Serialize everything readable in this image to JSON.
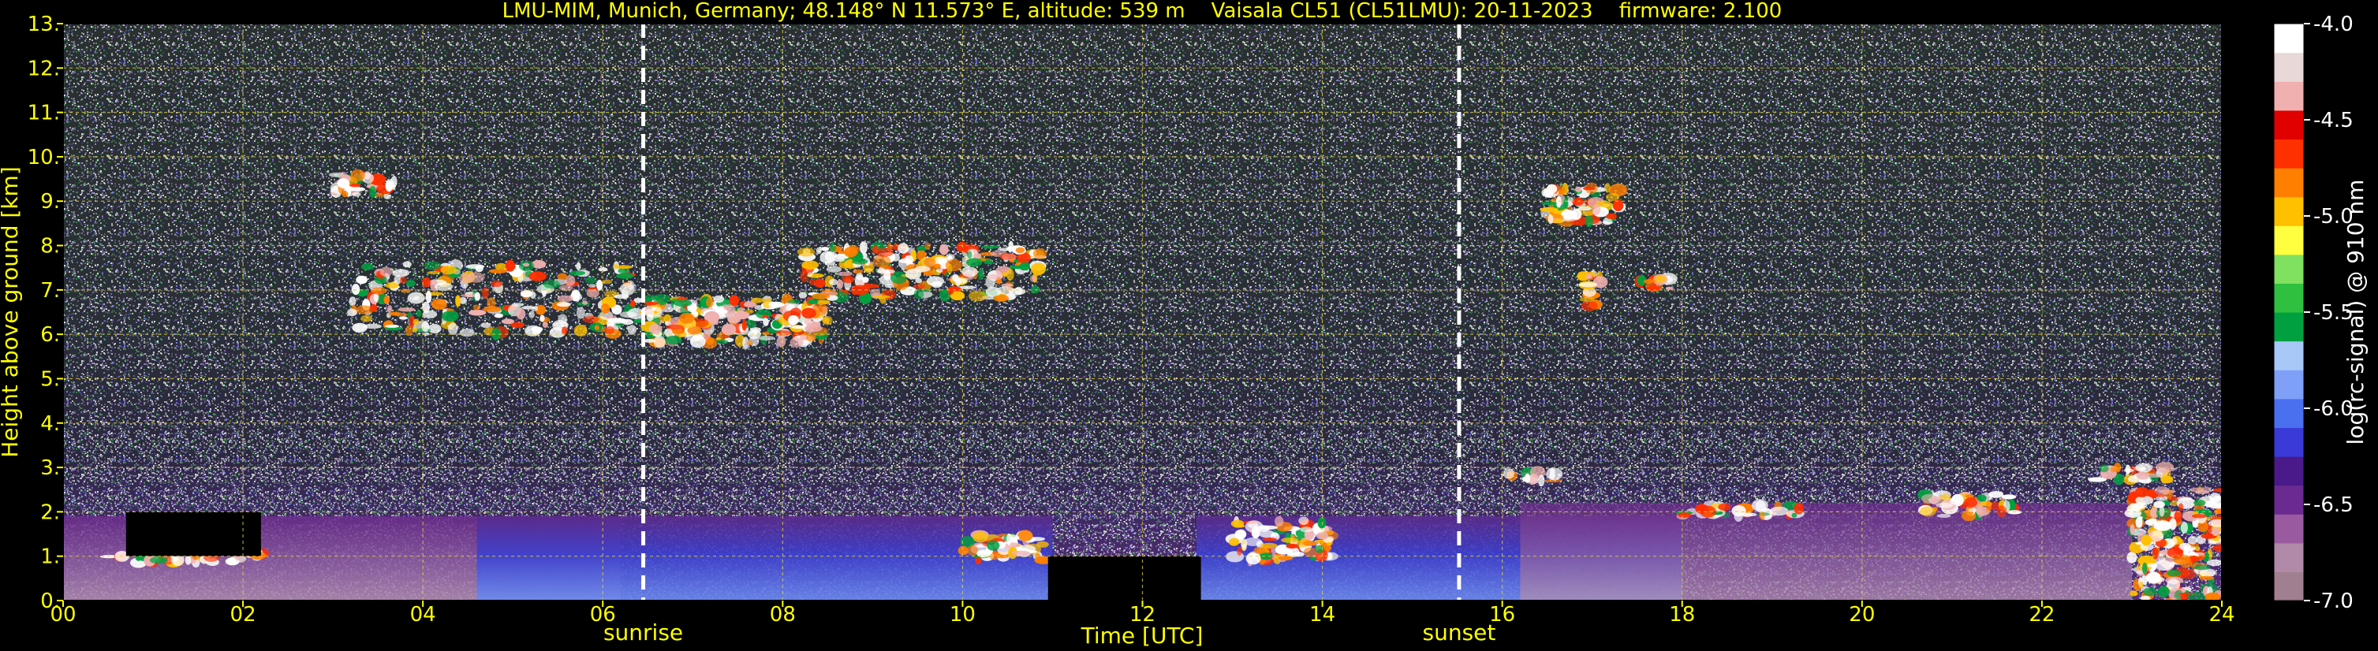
{
  "chart_data": {
    "type": "heatmap",
    "title": "LMU-MIM, Munich, Germany; 48.148° N 11.573° E, altitude: 539 m    Vaisala CL51 (CL51LMU): 20-11-2023    firmware: 2.100",
    "xlabel": "Time [UTC]",
    "ylabel": "Height above ground [km]",
    "xlim": [
      0,
      24
    ],
    "ylim": [
      0,
      13
    ],
    "x_ticks": [
      "00",
      "02",
      "04",
      "06",
      "08",
      "10",
      "12",
      "14",
      "16",
      "18",
      "20",
      "22",
      "24"
    ],
    "y_ticks": [
      "0.",
      "1.",
      "2.",
      "3.",
      "4.",
      "5.",
      "6.",
      "7.",
      "8.",
      "9.",
      "10.",
      "11.",
      "12.",
      "13."
    ],
    "grid": true,
    "colorbar": {
      "label": "log(rc-signal) @ 910 nm",
      "range": [
        -7.0,
        -4.0
      ],
      "ticks": [
        "-4.0",
        "-4.5",
        "-5.0",
        "-5.5",
        "-6.0",
        "-6.5",
        "-7.0"
      ],
      "colors": [
        "#a08090",
        "#b08aa8",
        "#9a5aa0",
        "#6a2a90",
        "#4a1a8a",
        "#3a3ad8",
        "#4a70f0",
        "#80a0f8",
        "#a8c8f8",
        "#00a040",
        "#30c040",
        "#80e060",
        "#ffff40",
        "#ffc000",
        "#ff8000",
        "#ff3000",
        "#e00000",
        "#f0b0b0",
        "#e8d8d8",
        "#ffffff"
      ]
    },
    "markers": [
      {
        "label": "sunrise",
        "x": 6.45
      },
      {
        "label": "sunset",
        "x": 15.52
      }
    ],
    "features": [
      {
        "type": "cloud",
        "x": [
          0.5,
          2.2
        ],
        "y": [
          0.85,
          1.1
        ]
      },
      {
        "type": "cloud",
        "x": [
          3.0,
          3.7
        ],
        "y": [
          9.1,
          9.6
        ]
      },
      {
        "type": "cloud",
        "x": [
          3.2,
          6.4
        ],
        "y": [
          6.0,
          7.6
        ]
      },
      {
        "type": "cloud",
        "x": [
          6.5,
          8.5
        ],
        "y": [
          5.8,
          6.8
        ]
      },
      {
        "type": "cloud",
        "x": [
          8.2,
          10.9
        ],
        "y": [
          6.8,
          8.0
        ]
      },
      {
        "type": "cloud",
        "x": [
          10.0,
          10.9
        ],
        "y": [
          0.9,
          1.5
        ]
      },
      {
        "type": "cloud",
        "x": [
          13.0,
          14.1
        ],
        "y": [
          0.9,
          1.8
        ]
      },
      {
        "type": "cloud",
        "x": [
          16.5,
          17.3
        ],
        "y": [
          8.5,
          9.3
        ]
      },
      {
        "type": "cloud",
        "x": [
          16.9,
          17.1
        ],
        "y": [
          6.6,
          7.4
        ]
      },
      {
        "type": "cloud",
        "x": [
          17.5,
          17.9
        ],
        "y": [
          7.0,
          7.3
        ]
      },
      {
        "type": "cloud",
        "x": [
          16.0,
          16.6
        ],
        "y": [
          2.7,
          2.9
        ]
      },
      {
        "type": "cloud",
        "x": [
          18.0,
          19.3
        ],
        "y": [
          1.9,
          2.15
        ]
      },
      {
        "type": "cloud",
        "x": [
          20.7,
          21.7
        ],
        "y": [
          1.9,
          2.4
        ]
      },
      {
        "type": "cloud",
        "x": [
          22.6,
          23.4
        ],
        "y": [
          2.7,
          3.0
        ]
      },
      {
        "type": "cloud",
        "x": [
          23.0,
          24.0
        ],
        "y": [
          0.0,
          2.5
        ]
      },
      {
        "type": "data-gap",
        "x": [
          10.95,
          12.65
        ],
        "y": [
          0.0,
          1.0
        ]
      },
      {
        "type": "data-gap",
        "x": [
          0.7,
          2.2
        ],
        "y": [
          1.0,
          2.0
        ]
      }
    ]
  }
}
